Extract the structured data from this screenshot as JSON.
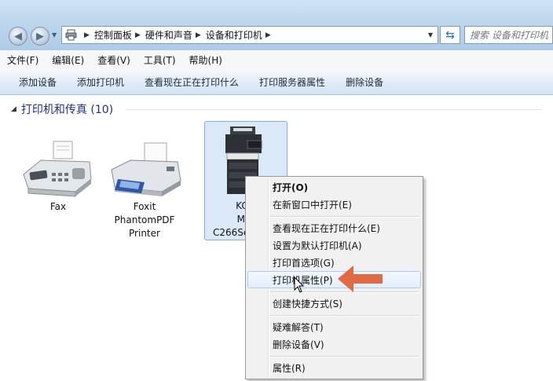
{
  "address_bar": {
    "crumbs": [
      "控制面板",
      "硬件和声音",
      "设备和打印机"
    ],
    "search_placeholder": "搜索 设备和打印机"
  },
  "menubar": [
    "文件(F)",
    "编辑(E)",
    "查看(V)",
    "工具(T)",
    "帮助(H)"
  ],
  "commandbar": [
    "添加设备",
    "添加打印机",
    "查看现在正在打印什么",
    "打印服务器属性",
    "删除设备"
  ],
  "group": {
    "title": "打印机和传真 (10)"
  },
  "devices": [
    {
      "name_lines": [
        "Fax"
      ]
    },
    {
      "name_lines": [
        "Foxit",
        "PhantomPDF",
        "Printer"
      ]
    },
    {
      "name_lines": [
        "KON",
        "MIN",
        "C266Se"
      ]
    }
  ],
  "context_menu": [
    {
      "label": "打开(O)",
      "bold": true
    },
    {
      "label": "在新窗口中打开(E)"
    },
    {
      "label": "查看现在正在打印什么(E)"
    },
    {
      "label": "设置为默认打印机(A)"
    },
    {
      "label": "打印首选项(G)"
    },
    {
      "label": "打印机属性(P)",
      "highlighted": true
    },
    {
      "label": "创建快捷方式(S)"
    },
    {
      "label": "疑难解答(T)"
    },
    {
      "label": "删除设备(V)"
    },
    {
      "label": "属性(R)"
    }
  ],
  "colors": {
    "annotation_arrow": "#e06a44",
    "group_title": "#1e3287"
  }
}
